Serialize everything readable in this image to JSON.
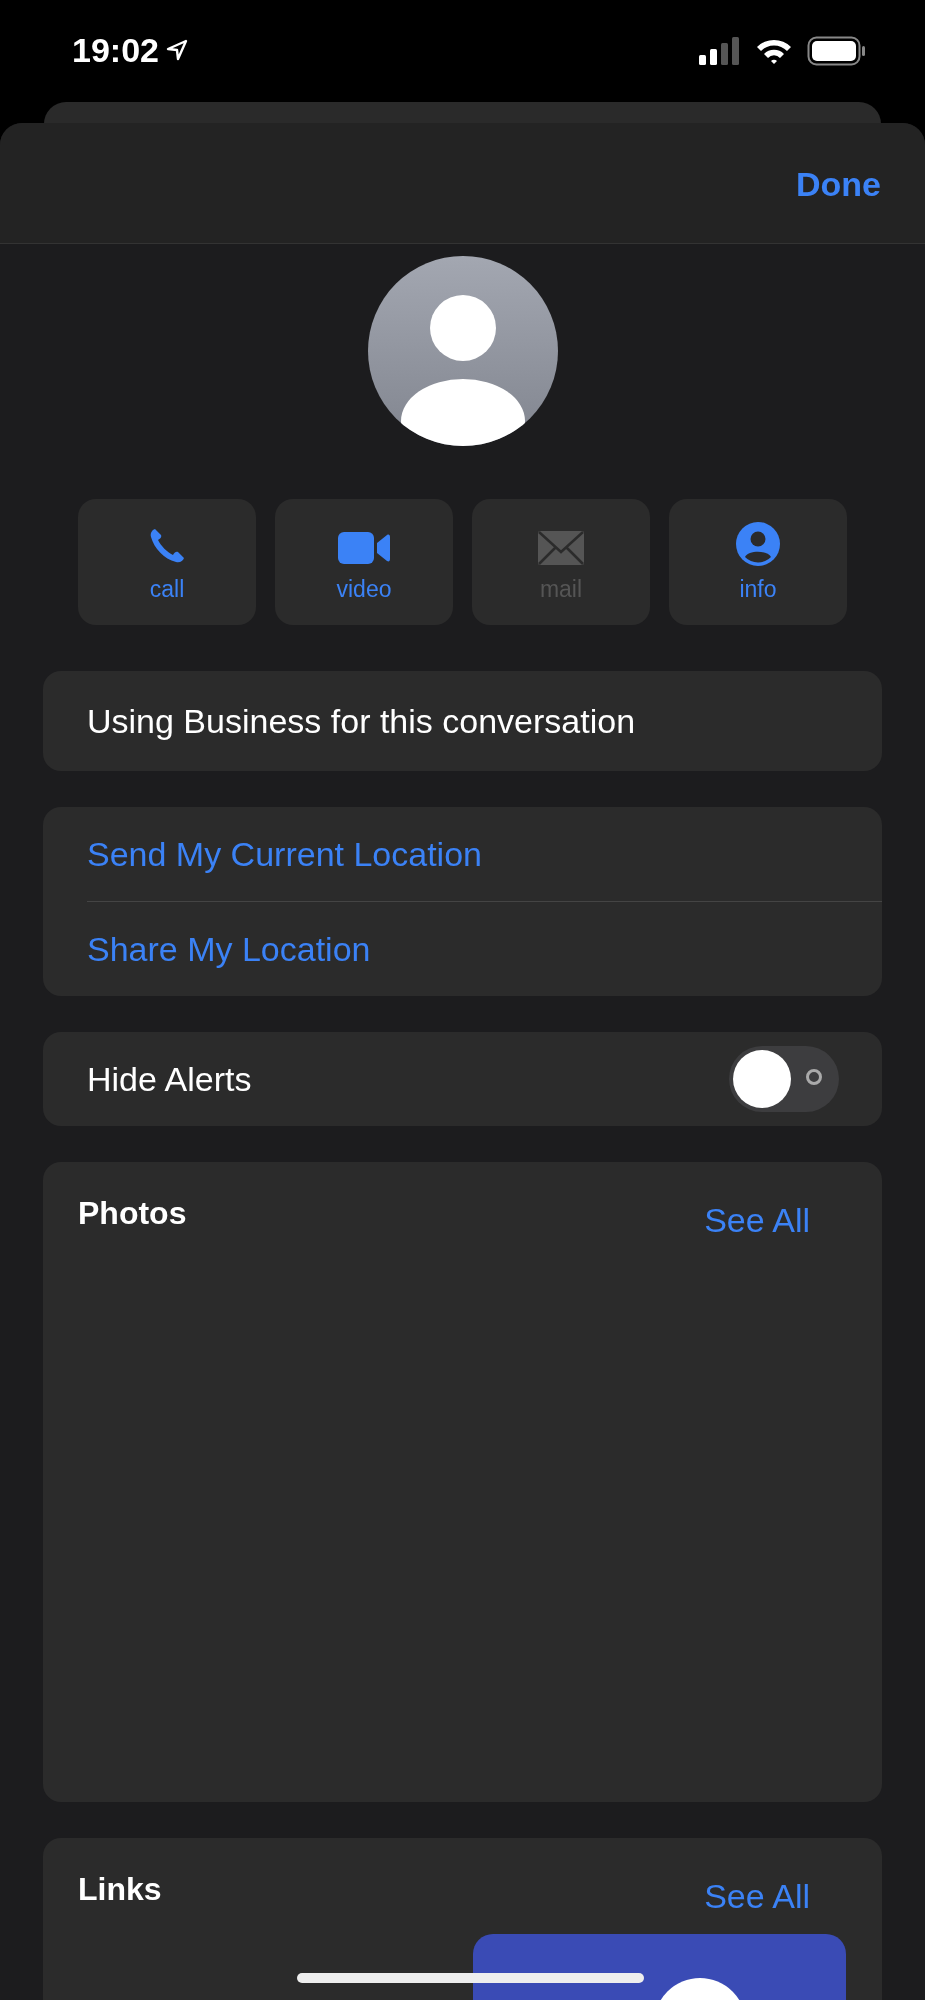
{
  "status_bar": {
    "time": "19:02"
  },
  "header": {
    "done": "Done"
  },
  "actions": [
    {
      "kind": "call",
      "label": "call",
      "disabled": false
    },
    {
      "kind": "video",
      "label": "video",
      "disabled": false
    },
    {
      "kind": "mail",
      "label": "mail",
      "disabled": true
    },
    {
      "kind": "info",
      "label": "info",
      "disabled": false
    }
  ],
  "business_note": "Using Business for this conversation",
  "location_items": [
    "Send My Current Location",
    "Share My Location"
  ],
  "hide_alerts": {
    "label": "Hide Alerts",
    "on": false
  },
  "photos": {
    "title": "Photos",
    "see_all": "See All"
  },
  "links": {
    "title": "Links",
    "see_all": "See All"
  }
}
